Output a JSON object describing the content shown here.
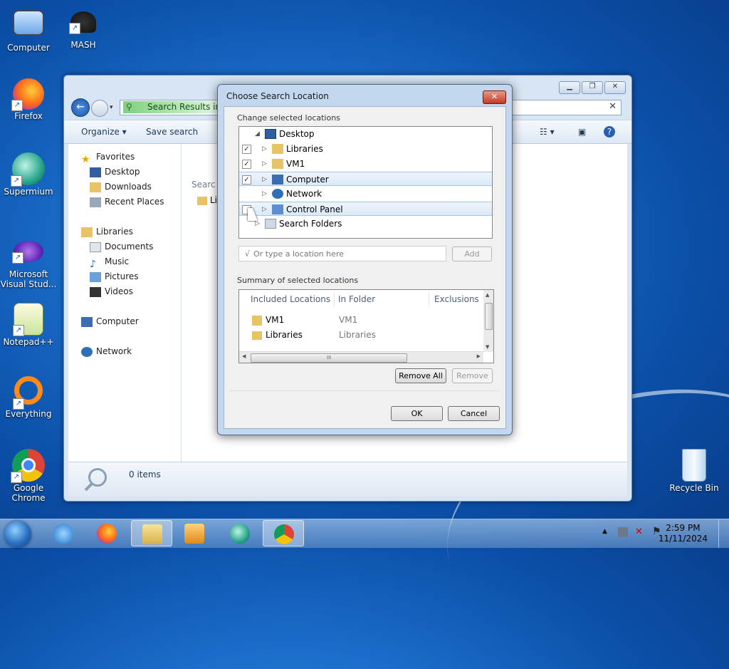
{
  "desktop": {
    "icons": [
      {
        "label": "Computer",
        "icon": "computer-icon"
      },
      {
        "label": "MASH",
        "icon": "mash-icon"
      },
      {
        "label": "Firefox",
        "icon": "firefox-icon"
      },
      {
        "label": "Supermium",
        "icon": "supermium-icon"
      },
      {
        "label": "Microsoft Visual Stud...",
        "icon": "visual-studio-icon"
      },
      {
        "label": "Notepad++",
        "icon": "notepadpp-icon"
      },
      {
        "label": "Everything",
        "icon": "everything-icon"
      },
      {
        "label": "Google Chrome",
        "icon": "chrome-icon"
      },
      {
        "label": "Recycle Bin",
        "icon": "recycle-bin-icon"
      }
    ]
  },
  "explorer": {
    "address": "Search Results in C",
    "toolbar": {
      "organize": "Organize ▾",
      "save_search": "Save search"
    },
    "nav": {
      "favorites": "Favorites",
      "desktop": "Desktop",
      "downloads": "Downloads",
      "recent": "Recent Places",
      "libraries": "Libraries",
      "documents": "Documents",
      "music": "Music",
      "pictures": "Pictures",
      "videos": "Videos",
      "computer": "Computer",
      "network": "Network"
    },
    "content": {
      "search_label": "Searc",
      "partial_item": "Li"
    },
    "status": {
      "items": "0 items"
    }
  },
  "dialog": {
    "title": "Choose Search Location",
    "change_label": "Change selected locations",
    "tree": [
      {
        "label": "Desktop",
        "checked": null
      },
      {
        "label": "Libraries",
        "checked": true
      },
      {
        "label": "VM1",
        "checked": true
      },
      {
        "label": "Computer",
        "checked": true
      },
      {
        "label": "Network",
        "checked": null
      },
      {
        "label": "Control Panel",
        "checked": false
      },
      {
        "label": "Search Folders",
        "checked": null
      }
    ],
    "location_placeholder": "Or type a location here",
    "add": "Add",
    "summary_label": "Summary of selected locations",
    "columns": {
      "included": "Included Locations",
      "in_folder": "In Folder",
      "exclusions": "Exclusions"
    },
    "rows": [
      {
        "name": "VM1",
        "folder": "VM1"
      },
      {
        "name": "Libraries",
        "folder": "Libraries"
      }
    ],
    "remove_all": "Remove All",
    "remove": "Remove",
    "ok": "OK",
    "cancel": "Cancel"
  },
  "taskbar": {
    "time": "2:59 PM",
    "date": "11/11/2024"
  }
}
